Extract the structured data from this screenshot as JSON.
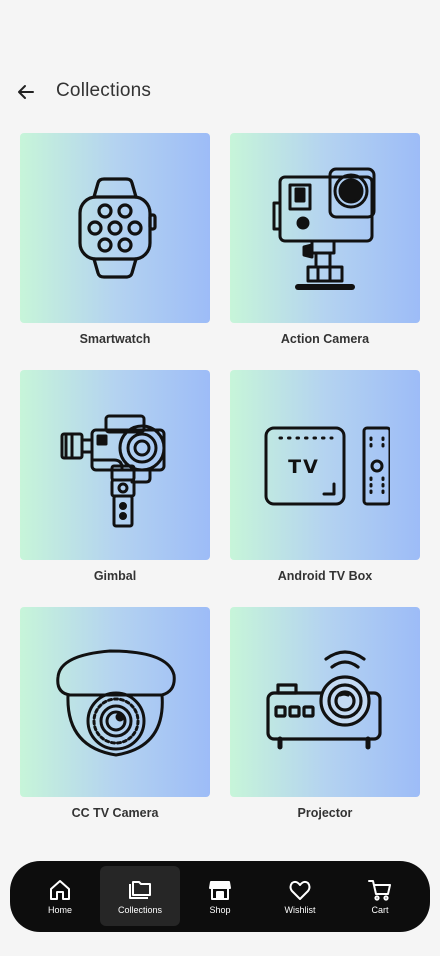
{
  "header": {
    "title": "Collections",
    "back_icon": "arrow-left-icon"
  },
  "collections": [
    {
      "label": "Smartwatch",
      "icon": "smartwatch-icon"
    },
    {
      "label": "Action Camera",
      "icon": "action-camera-icon"
    },
    {
      "label": "Gimbal",
      "icon": "gimbal-icon"
    },
    {
      "label": "Android TV Box",
      "icon": "tv-box-icon"
    },
    {
      "label": "CC TV Camera",
      "icon": "cctv-camera-icon"
    },
    {
      "label": "Projector",
      "icon": "projector-icon"
    }
  ],
  "nav": {
    "items": [
      {
        "label": "Home",
        "icon": "home-icon"
      },
      {
        "label": "Collections",
        "icon": "collections-icon",
        "active": true
      },
      {
        "label": "Shop",
        "icon": "shop-icon"
      },
      {
        "label": "Wishlist",
        "icon": "heart-icon"
      },
      {
        "label": "Cart",
        "icon": "cart-icon"
      }
    ]
  },
  "colors": {
    "tile_gradient_start": "#c7f5d9",
    "tile_gradient_end": "#9dbcf7",
    "nav_background": "#0d0d0d",
    "nav_active": "#262626"
  }
}
